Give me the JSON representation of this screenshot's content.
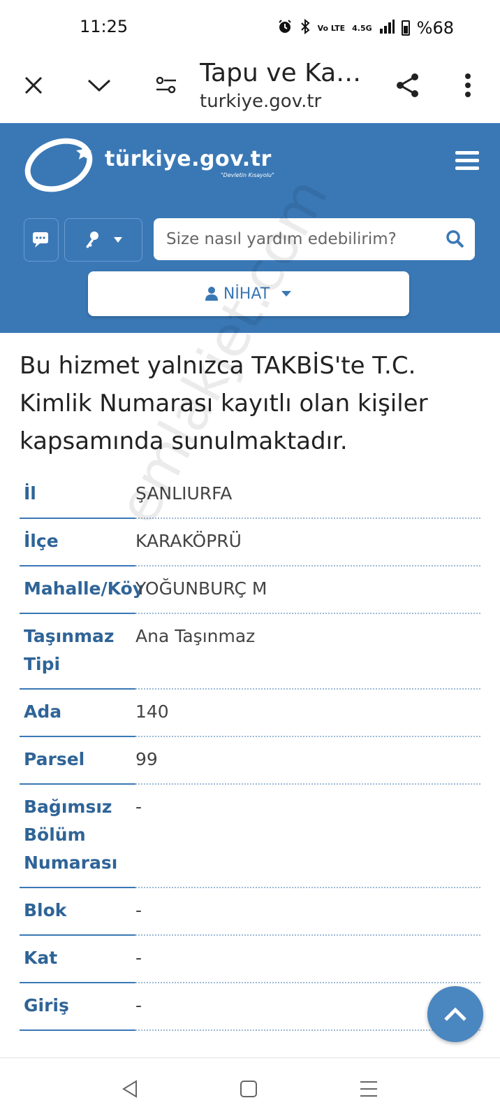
{
  "status_bar": {
    "time": "11:25",
    "network_label": "4.5G",
    "volte_label": "Vo LTE",
    "battery_text": "%68",
    "icons": [
      "alarm-icon",
      "bluetooth-icon",
      "volte-icon",
      "signal-icon",
      "battery-icon"
    ]
  },
  "browser": {
    "title": "Tapu ve Kad...",
    "url": "turkiye.gov.tr",
    "icons": [
      "close-icon",
      "chevron-down-icon",
      "site-settings-icon",
      "share-icon",
      "more-vert-icon"
    ]
  },
  "header": {
    "logo_text": "türkiye.gov.tr",
    "logo_sub": "\"Devletin Kısayolu\"",
    "search_placeholder": "Size nasıl yardım edebilirim?",
    "user_name": "NİHAT",
    "colors": {
      "brand": "#3a78b5",
      "label": "#2f6497"
    }
  },
  "intro_text": "Bu hizmet yalnızca TAKBİS'te T.C. Kimlik Numarası kayıtlı olan kişiler kapsamında sunulmaktadır.",
  "property": [
    {
      "label": "İl",
      "value": "ŞANLIURFA"
    },
    {
      "label": "İlçe",
      "value": "KARAKÖPRÜ"
    },
    {
      "label": "Mahalle/Köy",
      "value": "YOĞUNBURÇ M"
    },
    {
      "label": "Taşınmaz Tipi",
      "value": "Ana Taşınmaz"
    },
    {
      "label": "Ada",
      "value": "140"
    },
    {
      "label": "Parsel",
      "value": "99"
    },
    {
      "label": "Bağımsız Bölüm Numarası",
      "value": "-"
    },
    {
      "label": "Blok",
      "value": "-"
    },
    {
      "label": "Kat",
      "value": "-"
    },
    {
      "label": "Giriş",
      "value": "-"
    }
  ],
  "watermark": "emlakjet.com"
}
